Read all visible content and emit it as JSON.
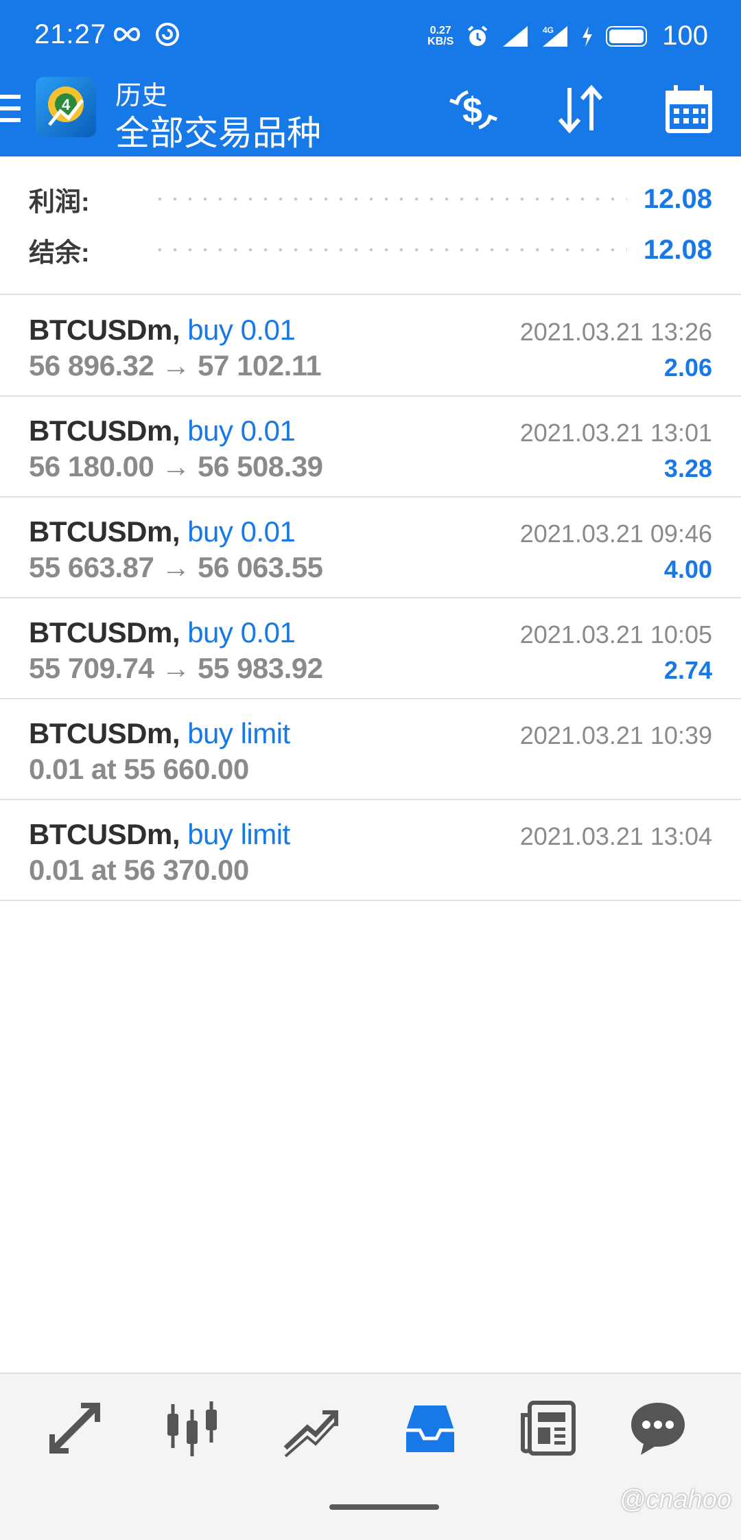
{
  "status_bar": {
    "time": "21:27",
    "net_speed_value": "0.27",
    "net_speed_unit": "KB/S",
    "network_type": "4G",
    "battery": "100",
    "icons": [
      "infinity-icon",
      "sync-icon",
      "alarm-icon",
      "signal-icon",
      "charging-icon",
      "battery-icon"
    ]
  },
  "app_bar": {
    "title_small": "历史",
    "title_big": "全部交易品种",
    "icons": [
      "menu-icon",
      "app-logo-icon",
      "currency-swap-icon",
      "sort-icon",
      "calendar-icon"
    ],
    "accent_color": "#1778e7"
  },
  "summary": {
    "profit_label": "利润:",
    "profit_value": "12.08",
    "balance_label": "结余:",
    "balance_value": "12.08"
  },
  "trades": [
    {
      "symbol": "BTCUSDm,",
      "action": "buy 0.01",
      "prices": "56 896.32 → 57 102.11",
      "date": "2021.03.21 13:26",
      "profit": "2.06"
    },
    {
      "symbol": "BTCUSDm,",
      "action": "buy 0.01",
      "prices": "56 180.00 → 56 508.39",
      "date": "2021.03.21 13:01",
      "profit": "3.28"
    },
    {
      "symbol": "BTCUSDm,",
      "action": "buy 0.01",
      "prices": "55 663.87 → 56 063.55",
      "date": "2021.03.21 09:46",
      "profit": "4.00"
    },
    {
      "symbol": "BTCUSDm,",
      "action": "buy 0.01",
      "prices": "55 709.74 → 55 983.92",
      "date": "2021.03.21 10:05",
      "profit": "2.74"
    },
    {
      "symbol": "BTCUSDm,",
      "action": "buy limit",
      "prices": "0.01 at 55 660.00",
      "date": "2021.03.21 10:39",
      "profit": ""
    },
    {
      "symbol": "BTCUSDm,",
      "action": "buy limit",
      "prices": "0.01 at 56 370.00",
      "date": "2021.03.21 13:04",
      "profit": ""
    }
  ],
  "bottom_nav": {
    "items": [
      "quotes-icon",
      "chart-icon",
      "trade-icon",
      "history-icon",
      "news-icon",
      "chat-icon"
    ],
    "active": "history-icon"
  },
  "watermark": "@cnahoo"
}
